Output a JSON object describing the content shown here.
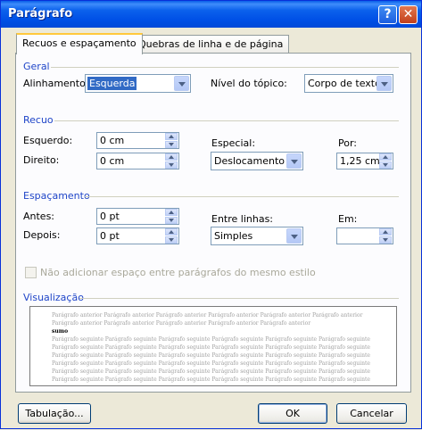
{
  "window": {
    "title": "Parágrafo",
    "help_button": "?",
    "close_button": "✕"
  },
  "tabs": [
    {
      "label": "Recuos e espaçamento",
      "active": true
    },
    {
      "label": "Quebras de linha e de página",
      "active": false
    }
  ],
  "geral": {
    "heading": "Geral",
    "alinhamento_label": "Alinhamento:",
    "alinhamento_value": "Esquerda",
    "nivel_label": "Nível do tópico:",
    "nivel_value": "Corpo de texto"
  },
  "recuo": {
    "heading": "Recuo",
    "esquerdo_label": "Esquerdo:",
    "esquerdo_value": "0 cm",
    "direito_label": "Direito:",
    "direito_value": "0 cm",
    "especial_label": "Especial:",
    "especial_value": "Deslocamento",
    "por_label": "Por:",
    "por_value": "1,25 cm"
  },
  "espacamento": {
    "heading": "Espaçamento",
    "antes_label": "Antes:",
    "antes_value": "0 pt",
    "depois_label": "Depois:",
    "depois_value": "0 pt",
    "entre_label": "Entre linhas:",
    "entre_value": "Simples",
    "em_label": "Em:",
    "em_value": ""
  },
  "no_space_checkbox": {
    "label": "Não adicionar espaço entre parágrafos do mesmo estilo",
    "checked": false,
    "enabled": false
  },
  "preview": {
    "heading": "Visualização",
    "lines": [
      "Parágrafo anterior Parágrafo anterior Parágrafo anterior Parágrafo anterior Parágrafo anterior Parágrafo anterior",
      "Parágrafo anterior Parágrafo anterior Parágrafo anterior Parágrafo anterior Parágrafo anterior",
      "sumo",
      "Parágrafo seguinte Parágrafo seguinte Parágrafo seguinte Parágrafo seguinte Parágrafo seguinte Parágrafo seguinte",
      "Parágrafo seguinte Parágrafo seguinte Parágrafo seguinte Parágrafo seguinte Parágrafo seguinte Parágrafo seguinte",
      "Parágrafo seguinte Parágrafo seguinte Parágrafo seguinte Parágrafo seguinte Parágrafo seguinte Parágrafo seguinte",
      "Parágrafo seguinte Parágrafo seguinte Parágrafo seguinte Parágrafo seguinte Parágrafo seguinte Parágrafo seguinte",
      "Parágrafo seguinte Parágrafo seguinte Parágrafo seguinte Parágrafo seguinte Parágrafo seguinte Parágrafo seguinte",
      "Parágrafo seguinte Parágrafo seguinte Parágrafo seguinte Parágrafo seguinte Parágrafo seguinte Parágrafo seguinte"
    ]
  },
  "buttons": {
    "tabulacao": "Tabulação...",
    "ok": "OK",
    "cancelar": "Cancelar"
  },
  "colors": {
    "section_heading": "#1f45c8",
    "titlebar": "#0054e3",
    "dialog_bg": "#ece9d8"
  }
}
